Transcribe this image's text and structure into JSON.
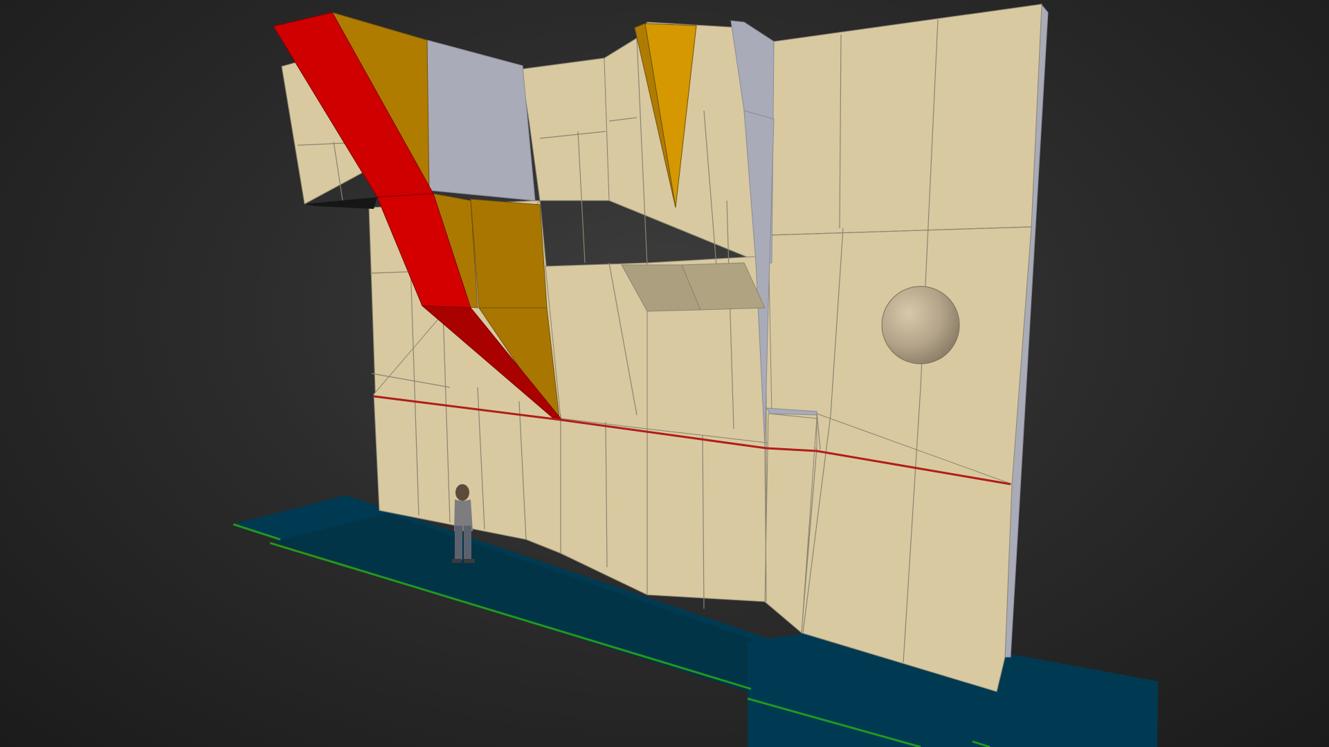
{
  "scene": {
    "colors": {
      "wall_panel": "#d8c9a0",
      "wall_panel_shaded": "#ab9f7f",
      "wall_side": "#a9abb8",
      "volume_red": "#cf0000",
      "volume_red_dark": "#a90000",
      "volume_orange": "#b07c00",
      "volume_orange_light": "#d59800",
      "safety_mat": "#003a52",
      "mat_edge": "#1f9a1f",
      "top_line": "#b21c18",
      "sphere": "#b3a48a"
    },
    "objects": [
      "wall-panels",
      "red-volume",
      "orange-volume",
      "spike-volume",
      "roof-shelf",
      "sphere-hold",
      "top-out-line",
      "crash-mats",
      "human-scale-figure"
    ]
  }
}
